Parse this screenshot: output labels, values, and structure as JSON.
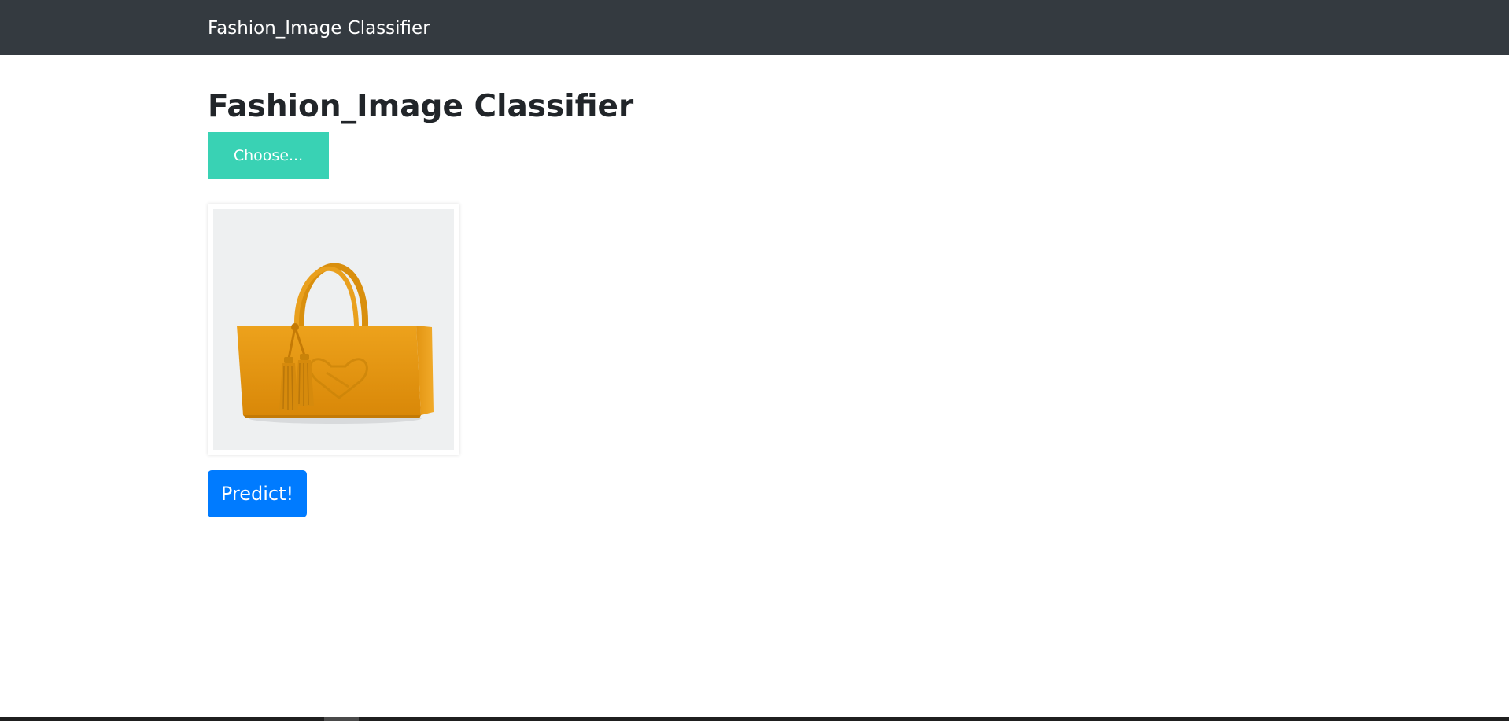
{
  "navbar": {
    "brand": "Fashion_Image Classifier"
  },
  "main": {
    "title": "Fashion_Image Classifier",
    "choose_label": "Choose...",
    "predict_label": "Predict!"
  },
  "preview": {
    "subject_icon": "handbag-photo"
  },
  "colors": {
    "navbar": "#343a40",
    "choose_button": "#39d2b4",
    "predict_button": "#007bff",
    "bag": "#e8960f"
  }
}
